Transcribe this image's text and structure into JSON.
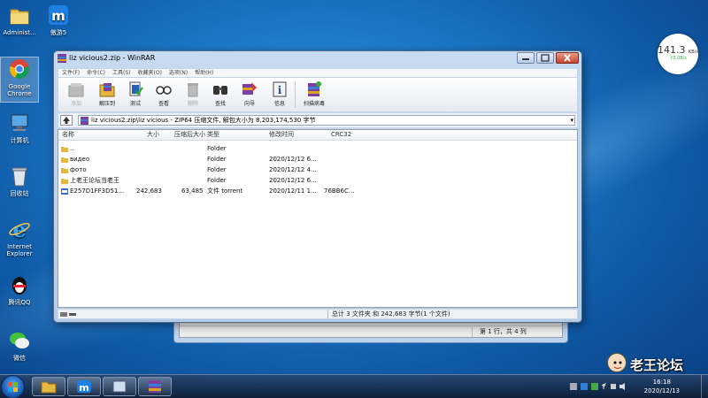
{
  "desktop": {
    "icons": [
      {
        "label": "Administ..."
      },
      {
        "label": "傲游5"
      },
      {
        "label": "Google Chrome"
      },
      {
        "label": "计算机"
      },
      {
        "label": "回收站"
      },
      {
        "label": "Internet Explorer"
      },
      {
        "label": "腾讯QQ"
      },
      {
        "label": "微信"
      }
    ]
  },
  "net_widget": {
    "speed": "141.3",
    "unit": "KB/s",
    "rate": "↑0.0B/s"
  },
  "background_window": {
    "status": "第 1 行，共 4 列"
  },
  "winrar": {
    "title": "liz vicious2.zip - WinRAR",
    "menu": [
      "文件(F)",
      "命令(C)",
      "工具(S)",
      "收藏夹(O)",
      "选项(N)",
      "帮助(H)"
    ],
    "toolbar": [
      {
        "label": "添加",
        "icon": "add-icon",
        "disabled": true
      },
      {
        "label": "解压到",
        "icon": "extract-icon",
        "disabled": false
      },
      {
        "label": "测试",
        "icon": "test-icon",
        "disabled": false
      },
      {
        "label": "查看",
        "icon": "view-icon",
        "disabled": false
      },
      {
        "label": "删除",
        "icon": "delete-icon",
        "disabled": true
      },
      {
        "label": "查找",
        "icon": "find-icon",
        "disabled": false
      },
      {
        "label": "向导",
        "icon": "wizard-icon",
        "disabled": false
      },
      {
        "label": "信息",
        "icon": "info-icon",
        "disabled": false
      },
      {
        "label": "扫描病毒",
        "icon": "virus-scan-icon",
        "disabled": false
      }
    ],
    "address": "liz vicious2.zip\\liz vicious - ZIP64 压缩文件, 解包大小为 8,203,174,530 字节",
    "columns": {
      "name": "名称",
      "size": "大小",
      "packed": "压缩后大小",
      "type": "类型",
      "modified": "修改时间",
      "crc": "CRC32"
    },
    "rows": [
      {
        "name": "..",
        "size": "",
        "packed": "",
        "type": "Folder",
        "modified": "",
        "crc": "",
        "icon": "folder-icon"
      },
      {
        "name": "видео",
        "size": "",
        "packed": "",
        "type": "Folder",
        "modified": "2020/12/12 6...",
        "crc": "",
        "icon": "folder-icon"
      },
      {
        "name": "фото",
        "size": "",
        "packed": "",
        "type": "Folder",
        "modified": "2020/12/12 4...",
        "crc": "",
        "icon": "folder-icon"
      },
      {
        "name": "上老王论坛当老王",
        "size": "",
        "packed": "",
        "type": "Folder",
        "modified": "2020/12/12 6...",
        "crc": "",
        "icon": "folder-icon"
      },
      {
        "name": "E257D1FF3D51...",
        "size": "242,683",
        "packed": "63,485",
        "type": "文件 torrent",
        "modified": "2020/12/11 1...",
        "crc": "76BB6C...",
        "icon": "torrent-file-icon"
      }
    ],
    "status": "总计 3 文件夹 和 242,683 字节(1 个文件)"
  },
  "taskbar": {
    "clock_time": "16:18",
    "clock_date": "2020/12/13",
    "apps": [
      "file-explorer",
      "maxthon",
      "blank-window",
      "winrar"
    ]
  },
  "watermark": {
    "text": "老王论坛"
  }
}
